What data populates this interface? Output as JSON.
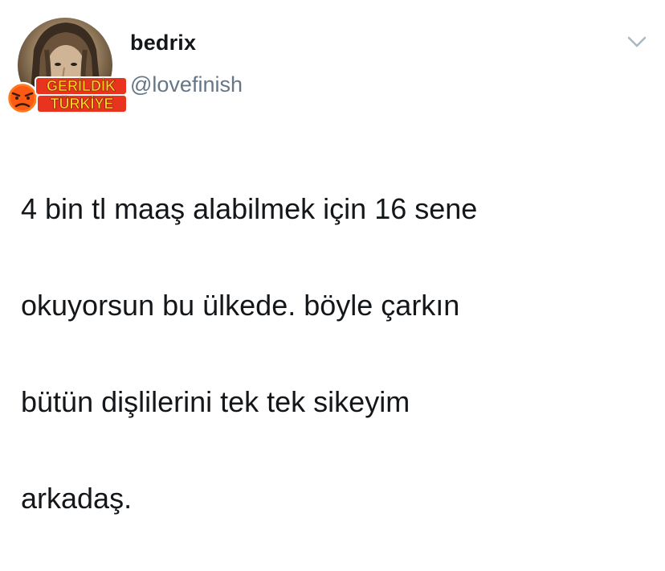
{
  "user": {
    "display_name": "bedrix",
    "handle": "@lovefinish"
  },
  "watermark": {
    "line1": "GERİLDİK",
    "line2": "TÜRKİYE"
  },
  "tweet": {
    "text_lines": [
      "4 bin tl maaş alabilmek için 16 sene",
      "okuyorsun bu ülkede. böyle çarkın",
      "bütün dişlilerini tek tek sikeyim",
      "arkadaş."
    ]
  },
  "icons": {
    "menu": "chevron-down-icon",
    "watermark_emoji": "angry-face-icon"
  },
  "colors": {
    "text": "#14171a",
    "secondary": "#657786",
    "chevron": "#aab8c2",
    "watermark_fill": "#e8331f",
    "watermark_text": "#ffd21f"
  }
}
